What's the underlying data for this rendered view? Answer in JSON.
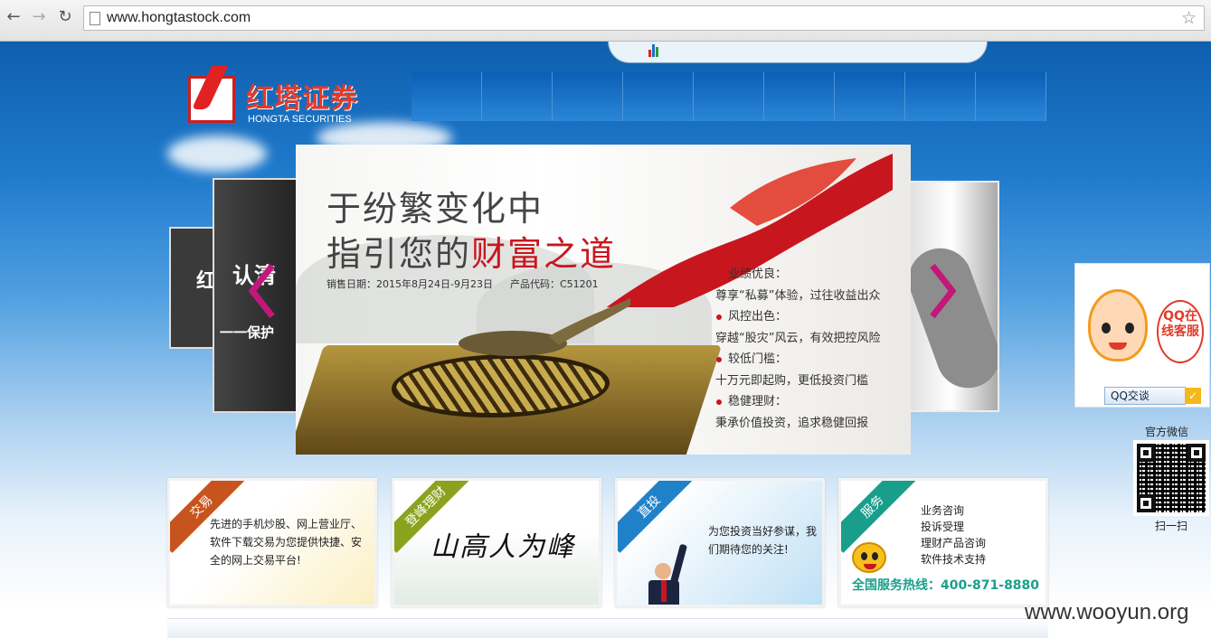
{
  "browser": {
    "url": "www.hongtastock.com",
    "back_icon": "←",
    "forward_icon": "→",
    "reload_icon": "↻",
    "star_icon": "☆"
  },
  "site": {
    "logo_cn": "红塔证券",
    "logo_en": "HONGTA SECURITIES"
  },
  "carousel": {
    "left_card_text": "认清",
    "left_card_sub": "一一保护",
    "far_left_text": "红",
    "headline_1": "于纷繁变化中",
    "headline_2_prefix": "指引您的",
    "headline_2_highlight": "财富之道",
    "sale_date": "销售日期：2015年8月24日-9月23日",
    "product_code": "产品代码：C51201",
    "features": [
      {
        "title": "业绩优良：",
        "desc": "尊享“私募”体验，过往收益出众"
      },
      {
        "title": "风控出色：",
        "desc": "穿越“股灾”风云，有效把控风险"
      },
      {
        "title": "较低门槛：",
        "desc": "十万元即起购，更低投资门槛"
      },
      {
        "title": "稳健理财：",
        "desc": "秉承价值投资，追求稳健回报"
      }
    ]
  },
  "cards": [
    {
      "tag": "交易",
      "text": "先进的手机炒股、网上营业厅、软件下载交易为您提供快捷、安全的网上交易平台!",
      "color": "#c7541c"
    },
    {
      "tag": "登峰理财",
      "calligraphy": "山高人为峰",
      "color": "#8aa21d"
    },
    {
      "tag": "直投",
      "text": "为您投资当好参谋，我们期待您的关注!",
      "color": "#1f82c9"
    },
    {
      "tag": "服务",
      "items": [
        "业务咨询",
        "投诉受理",
        "理财产品咨询",
        "软件技术支持"
      ],
      "hotline": "全国服务热线：400-871-8880",
      "color": "#1a9e8c"
    }
  ],
  "qq_widget": {
    "bubble": "QQ在线客服",
    "button": "QQ交谈"
  },
  "wechat": {
    "title": "官方微信",
    "scan": "扫一扫"
  },
  "watermark": "www.wooyun.org"
}
